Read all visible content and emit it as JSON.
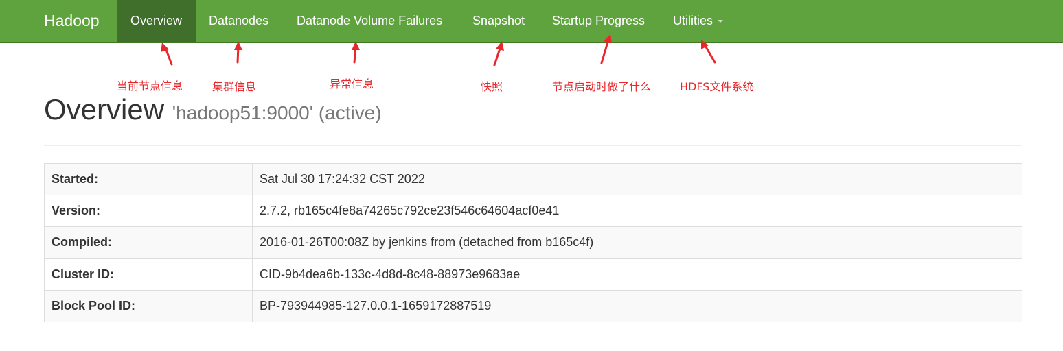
{
  "navbar": {
    "brand": "Hadoop",
    "items": [
      {
        "label": "Overview",
        "active": true
      },
      {
        "label": "Datanodes"
      },
      {
        "label": "Datanode Volume Failures"
      },
      {
        "label": "Snapshot"
      },
      {
        "label": "Startup Progress"
      },
      {
        "label": "Utilities",
        "dropdown": true
      }
    ],
    "colors": {
      "background": "#5fa33e",
      "active": "#3f6f2a"
    }
  },
  "annotations": [
    {
      "text": "当前节点信息"
    },
    {
      "text": "集群信息"
    },
    {
      "text": "异常信息"
    },
    {
      "text": "快照"
    },
    {
      "text": "节点启动时做了什么"
    },
    {
      "text": "HDFS文件系统"
    }
  ],
  "annotation_color": "#e8272b",
  "page": {
    "title": "Overview",
    "subtitle": "'hadoop51:9000' (active)"
  },
  "info_table": [
    {
      "key": "Started:",
      "value": "Sat Jul 30 17:24:32 CST 2022"
    },
    {
      "key": "Version:",
      "value": "2.7.2, rb165c4fe8a74265c792ce23f546c64604acf0e41"
    },
    {
      "key": "Compiled:",
      "value": "2016-01-26T00:08Z by jenkins from (detached from b165c4f)"
    },
    {
      "key": "Cluster ID:",
      "value": "CID-9b4dea6b-133c-4d8d-8c48-88973e9683ae"
    },
    {
      "key": "Block Pool ID:",
      "value": "BP-793944985-127.0.0.1-1659172887519"
    }
  ]
}
